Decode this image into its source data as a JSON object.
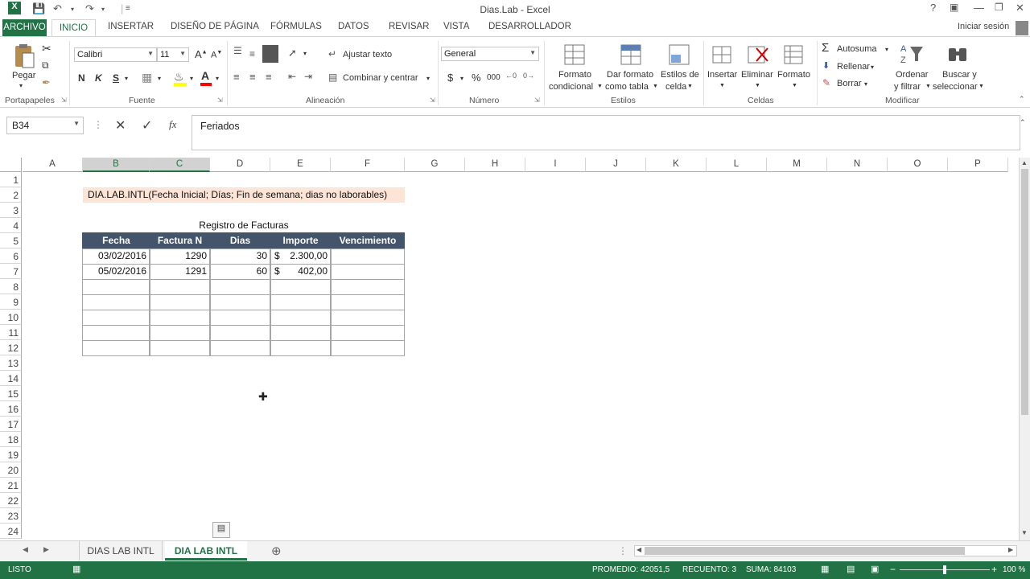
{
  "app": {
    "title": "Dias.Lab - Excel",
    "signin": "Iniciar sesión",
    "help": "?"
  },
  "tabs": [
    "ARCHIVO",
    "INICIO",
    "INSERTAR",
    "DISEÑO DE PÁGINA",
    "FÓRMULAS",
    "DATOS",
    "REVISAR",
    "VISTA",
    "DESARROLLADOR"
  ],
  "ribbon": {
    "paste": "Pegar",
    "font_name": "Calibri",
    "font_size": "11",
    "bold": "N",
    "italic": "K",
    "underline": "S",
    "wrap": "Ajustar texto",
    "merge": "Combinar y centrar",
    "number_format": "General",
    "currency": "$",
    "percent": "%",
    "thousands": "000",
    "cond_format_1": "Formato",
    "cond_format_2": "condicional",
    "table_format_1": "Dar formato",
    "table_format_2": "como tabla",
    "cell_styles_1": "Estilos de",
    "cell_styles_2": "celda",
    "insert": "Insertar",
    "delete": "Eliminar",
    "format": "Formato",
    "autosum": "Autosuma",
    "fill": "Rellenar",
    "clear": "Borrar",
    "sort_1": "Ordenar",
    "sort_2": "y filtrar",
    "find_1": "Buscar y",
    "find_2": "seleccionar",
    "groups": {
      "clipboard": "Portapapeles",
      "font": "Fuente",
      "alignment": "Alineación",
      "number": "Número",
      "styles": "Estilos",
      "cells": "Celdas",
      "editing": "Modificar"
    }
  },
  "formula_bar": {
    "name_box": "B34",
    "fx": "fx",
    "content": "Feriados"
  },
  "grid": {
    "columns": [
      "A",
      "B",
      "C",
      "D",
      "E",
      "F",
      "G",
      "H",
      "I",
      "J",
      "K",
      "L",
      "M",
      "N",
      "O",
      "P"
    ],
    "rows": [
      "1",
      "2",
      "3",
      "4",
      "5",
      "6",
      "7",
      "8",
      "9",
      "10",
      "11",
      "12",
      "13",
      "14",
      "15",
      "16",
      "17",
      "18",
      "19",
      "20",
      "21",
      "22",
      "23",
      "24"
    ],
    "syntax_note": "DIA.LAB.INTL(Fecha Inicial; Días; Fin de semana; dias no laborables)",
    "table_title": "Registro de Facturas",
    "headers": [
      "Fecha",
      "Factura N",
      "Dias",
      "Importe",
      "Vencimiento"
    ],
    "records": [
      {
        "fecha": "03/02/2016",
        "factura": "1290",
        "dias": "30",
        "moneda": "$",
        "importe": "2.300,00"
      },
      {
        "fecha": "05/02/2016",
        "factura": "1291",
        "dias": "60",
        "moneda": "$",
        "importe": "402,00"
      }
    ]
  },
  "sheets": {
    "tabs": [
      "DIAS LAB INTL",
      "DIA LAB INTL"
    ],
    "active": "DIA LAB INTL"
  },
  "status": {
    "mode": "LISTO",
    "average": "PROMEDIO: 42051,5",
    "count": "RECUENTO: 3",
    "sum": "SUMA: 84103",
    "zoom": "100 %"
  },
  "colors": {
    "excel_green": "#217346",
    "header_fill": "#44546A",
    "note_fill": "#FCE4D6"
  }
}
